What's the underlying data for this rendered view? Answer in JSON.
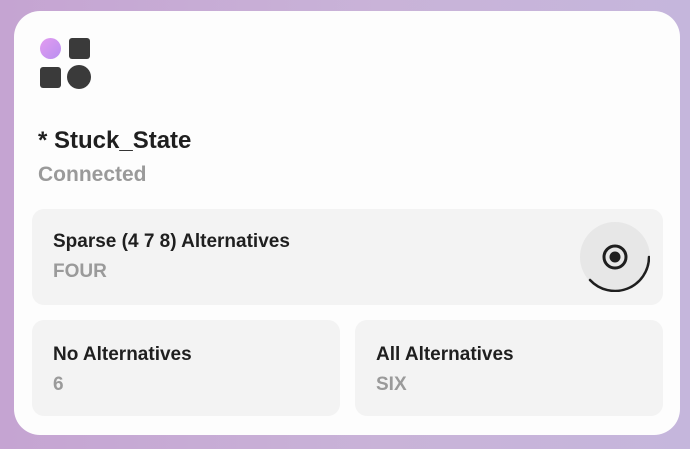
{
  "device": {
    "name": "* Stuck_State",
    "status": "Connected"
  },
  "controls": [
    {
      "label": "Sparse (4 7 8) Alternatives",
      "value": "FOUR"
    },
    {
      "label": "No Alternatives",
      "value": "6"
    },
    {
      "label": "All Alternatives",
      "value": "SIX"
    }
  ],
  "icons": {
    "app": "shapes-icon",
    "selector": "radio-target-icon"
  },
  "colors": {
    "icon_gradient_start": "#e39cf0",
    "icon_gradient_end": "#b98ff0",
    "title": "#1f1f1f",
    "muted": "#9a9a9a",
    "tile": "#f3f3f3"
  }
}
